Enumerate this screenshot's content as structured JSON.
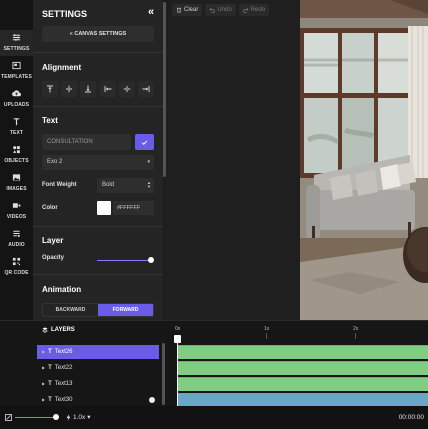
{
  "rail": {
    "items": [
      {
        "label": "SETTINGS",
        "icon": "sliders-icon"
      },
      {
        "label": "TEMPLATES",
        "icon": "templates-icon"
      },
      {
        "label": "UPLOADS",
        "icon": "cloud-upload-icon"
      },
      {
        "label": "TEXT",
        "icon": "text-icon"
      },
      {
        "label": "OBJECTS",
        "icon": "shapes-icon"
      },
      {
        "label": "IMAGES",
        "icon": "image-icon"
      },
      {
        "label": "VIDEOS",
        "icon": "video-icon"
      },
      {
        "label": "AUDIO",
        "icon": "audio-icon"
      },
      {
        "label": "QR CODE",
        "icon": "qr-code-icon"
      }
    ]
  },
  "settings": {
    "title": "SETTINGS",
    "collapse_glyph": "«",
    "canvas_settings_label": "« CANVAS SETTINGS",
    "alignment_heading": "Alignment",
    "text_heading": "Text",
    "text_placeholder": "CONSULTATION",
    "font_value": "Exo 2",
    "font_weight_label": "Font Weight",
    "font_weight_value": "Bold",
    "color_label": "Color",
    "color_hex": "#FFFFFF",
    "layer_heading": "Layer",
    "opacity_label": "Opacity",
    "opacity_value": 1.0,
    "animation_heading": "Animation",
    "animation_backward": "BACKWARD",
    "animation_forward": "FORWARD"
  },
  "toolbar": {
    "clear_label": "Clear",
    "undo_label": "Undo",
    "redo_label": "Redo"
  },
  "layers": {
    "heading": "LAYERS",
    "items": [
      {
        "name": "Text26",
        "selected": true
      },
      {
        "name": "Text22",
        "selected": false
      },
      {
        "name": "Text13",
        "selected": false
      },
      {
        "name": "Text30",
        "selected": false
      }
    ]
  },
  "timeline": {
    "ticks": [
      "0s",
      "1s",
      "2s"
    ]
  },
  "footer": {
    "speed_label": "1.0x",
    "time_label": "00:00:00"
  },
  "colors": {
    "accent": "#6b5ce7",
    "track_green": "#7fce84",
    "track_blue": "#6aa7c4",
    "panel_bg": "#242424"
  }
}
